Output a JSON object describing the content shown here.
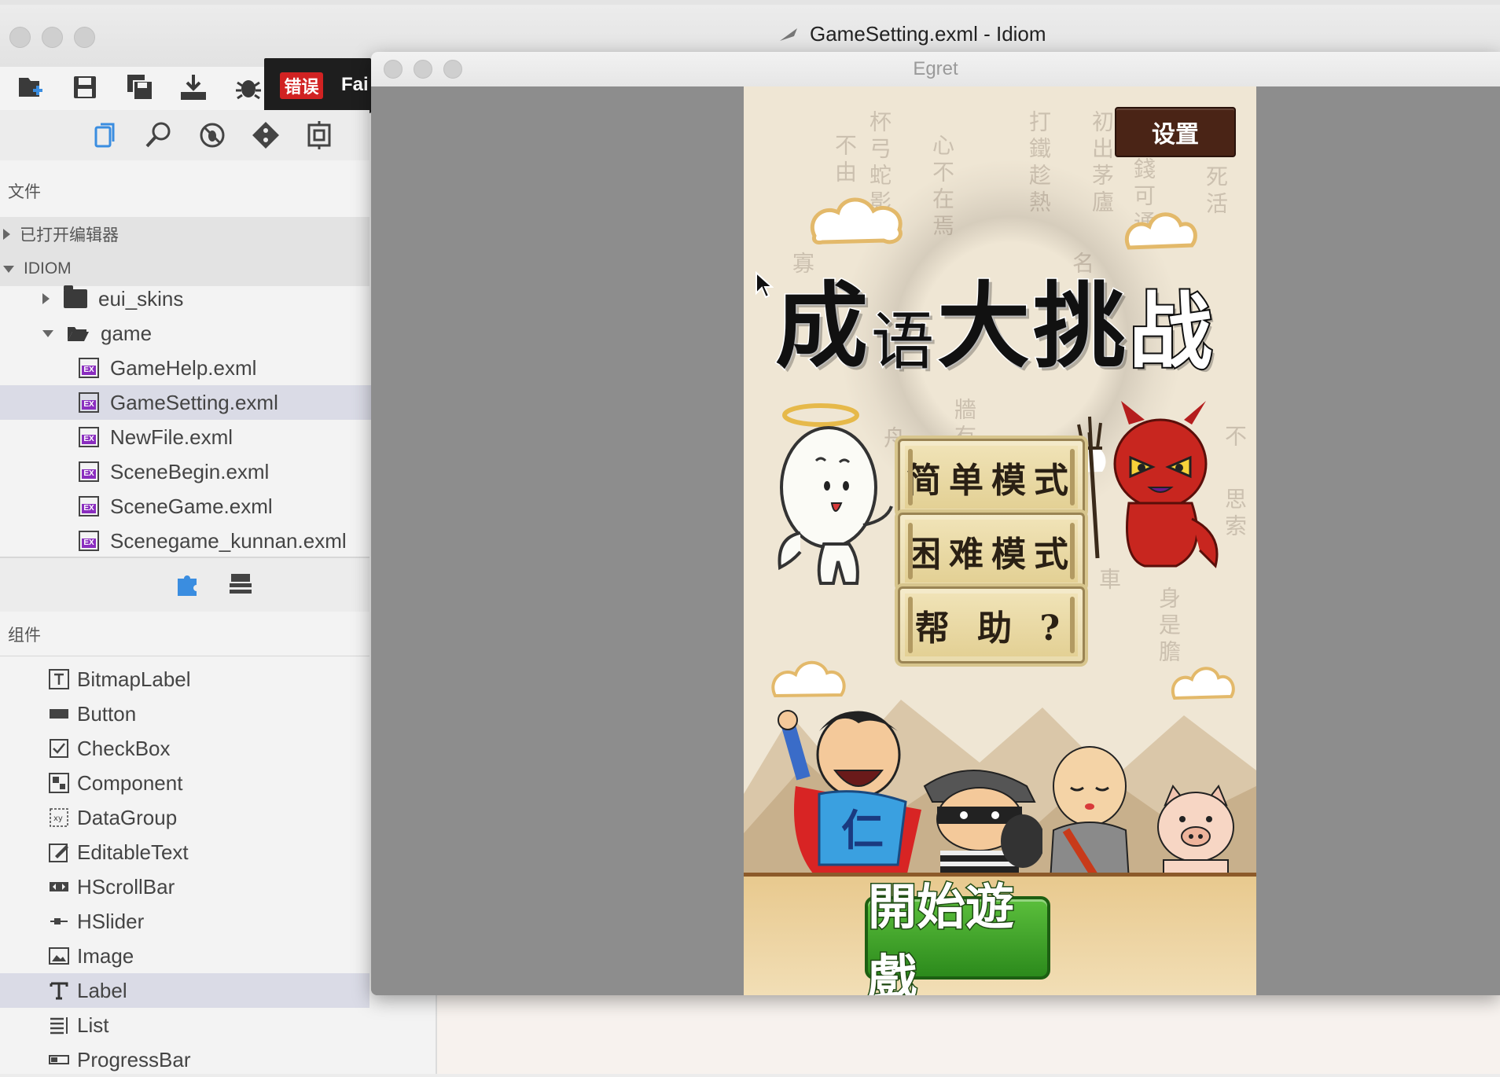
{
  "window": {
    "title": "GameSetting.exml - Idiom"
  },
  "toolbar": {
    "icons": [
      "new-folder-icon",
      "save-icon",
      "save-all-icon",
      "download-icon",
      "debug-bug-icon"
    ],
    "error_badge": "错误",
    "error_text": "Fai"
  },
  "sidebar": {
    "view_icons": [
      "files-icon",
      "search-icon",
      "debug-icon",
      "git-icon",
      "extensions-icon"
    ],
    "files_header": "文件",
    "open_editors": "已打开编辑器",
    "project": "IDIOM",
    "tree": [
      {
        "type": "folder",
        "label": "eui_skins",
        "expanded": false
      },
      {
        "type": "folder",
        "label": "game",
        "expanded": true
      },
      {
        "type": "file",
        "label": "GameHelp.exml"
      },
      {
        "type": "file",
        "label": "GameSetting.exml",
        "selected": true
      },
      {
        "type": "file",
        "label": "NewFile.exml"
      },
      {
        "type": "file",
        "label": "SceneBegin.exml"
      },
      {
        "type": "file",
        "label": "SceneGame.exml"
      },
      {
        "type": "file",
        "label": "Scenegame_kunnan.exml"
      }
    ],
    "lower_icons": [
      "puzzle-icon",
      "layers-icon"
    ],
    "components_header": "组件",
    "components": [
      {
        "label": "BitmapLabel",
        "icon": "bitmaplabel-icon"
      },
      {
        "label": "Button",
        "icon": "button-icon"
      },
      {
        "label": "CheckBox",
        "icon": "checkbox-icon"
      },
      {
        "label": "Component",
        "icon": "component-icon"
      },
      {
        "label": "DataGroup",
        "icon": "datagroup-icon"
      },
      {
        "label": "EditableText",
        "icon": "editabletext-icon"
      },
      {
        "label": "HScrollBar",
        "icon": "hscrollbar-icon"
      },
      {
        "label": "HSlider",
        "icon": "hslider-icon"
      },
      {
        "label": "Image",
        "icon": "image-icon"
      },
      {
        "label": "Label",
        "icon": "label-icon",
        "selected": true
      },
      {
        "label": "List",
        "icon": "list-icon"
      },
      {
        "label": "ProgressBar",
        "icon": "progressbar-icon"
      }
    ]
  },
  "egret": {
    "title": "Egret",
    "game": {
      "settings_button": "设置",
      "logo": [
        "成",
        "语",
        "大",
        "挑",
        "战"
      ],
      "buttons": [
        "简单模式",
        "困难模式",
        "帮 助 ?"
      ],
      "start_button": "開始遊戲",
      "background_chars": [
        "杯弓蛇影",
        "不由",
        "心不在焉",
        "打鐵趁熱",
        "初出茅廬",
        "錢可通",
        "死活",
        "寡",
        "名",
        "不",
        "思索",
        "車",
        "身是膽",
        "牆有耳",
        "舟"
      ]
    }
  },
  "colors": {
    "settings_bg": "#4a2416",
    "start_green": "#3fa62a",
    "error_red": "#d12222",
    "selection": "#dadbe6",
    "stage_gray": "#8d8d8d"
  }
}
